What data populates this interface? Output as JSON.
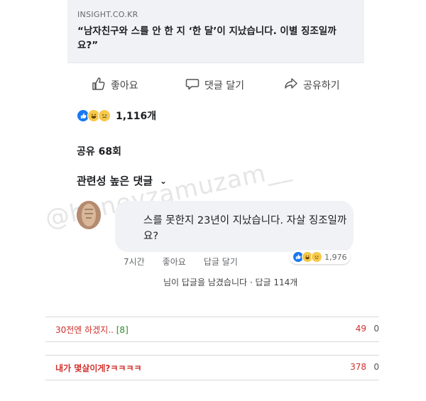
{
  "post": {
    "domain": "INSIGHT.CO.KR",
    "headline": "“남자친구와   스를 안 한 지 ‘한 달’이 지났습니다. 이별 징조일까요?”"
  },
  "actions": {
    "like": "좋아요",
    "comment": "댓글 달기",
    "share": "공유하기"
  },
  "reactions": {
    "count": "1,116개"
  },
  "shares": "공유 68회",
  "sort": {
    "label": "관련성 높은 댓글",
    "chevron": "⌄"
  },
  "comment": {
    "text": "  스를 못한지 23년이 지났습니다. 자살 징조일까요?",
    "time": "7시간",
    "like": "좋아요",
    "reply": "답글 달기",
    "reaction_count": "1,976",
    "replies": "님이 답글을 남겼습니다 · 답글 114개"
  },
  "watermark": "@honeyzamuzam__",
  "community_comments": [
    {
      "text": "30전엔 하겠지..",
      "count": "[8]",
      "likes": "49",
      "dislikes": "0"
    },
    {
      "text": "내가 몇살이게?ㅋㅋㅋㅋ",
      "count": "",
      "likes": "378",
      "dislikes": "0"
    }
  ],
  "colors": {
    "facebook_blue": "#1877f2",
    "reaction_yellow": "#f7c84a",
    "comment_red": "#d0312d",
    "reply_count_green": "#2b8a2b"
  }
}
